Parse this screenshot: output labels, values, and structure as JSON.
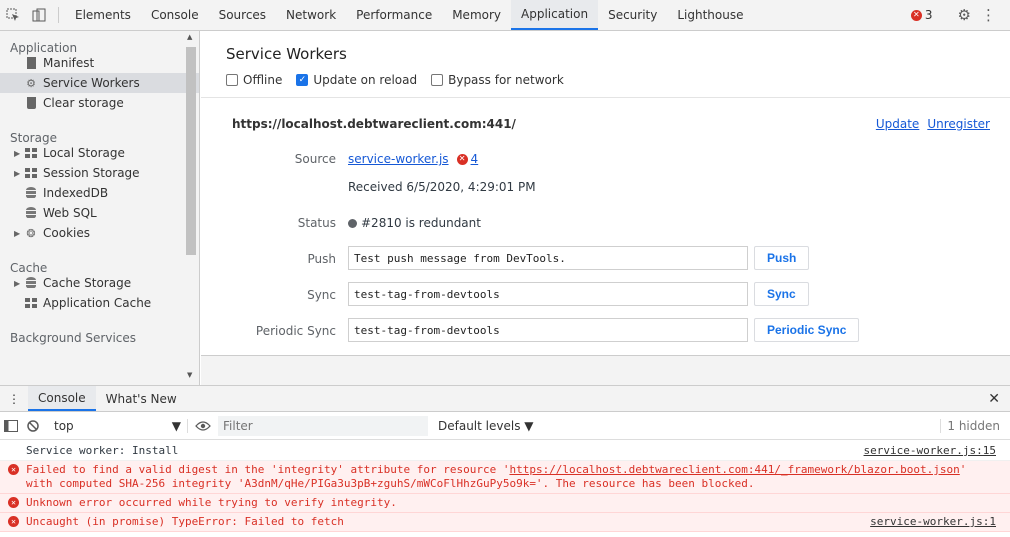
{
  "toolbar": {
    "tabs": [
      "Elements",
      "Console",
      "Sources",
      "Network",
      "Performance",
      "Memory",
      "Application",
      "Security",
      "Lighthouse"
    ],
    "active_tab": "Application",
    "error_count": "3"
  },
  "sidebar": {
    "application": {
      "title": "Application",
      "items": [
        "Manifest",
        "Service Workers",
        "Clear storage"
      ]
    },
    "storage": {
      "title": "Storage",
      "items": [
        "Local Storage",
        "Session Storage",
        "IndexedDB",
        "Web SQL",
        "Cookies"
      ]
    },
    "cache": {
      "title": "Cache",
      "items": [
        "Cache Storage",
        "Application Cache"
      ]
    },
    "background": {
      "title": "Background Services"
    }
  },
  "main": {
    "title": "Service Workers",
    "options": [
      {
        "label": "Offline",
        "checked": false
      },
      {
        "label": "Update on reload",
        "checked": true
      },
      {
        "label": "Bypass for network",
        "checked": false
      }
    ],
    "origin": "https://localhost.debtwareclient.com:441/",
    "update_label": "Update",
    "unregister_label": "Unregister",
    "source_label": "Source",
    "source_file": "service-worker.js",
    "source_errors": "4",
    "received": "Received 6/5/2020, 4:29:01 PM",
    "status_label": "Status",
    "status_value": "#2810 is redundant",
    "push_label": "Push",
    "push_value": "Test push message from DevTools.",
    "push_button": "Push",
    "sync_label": "Sync",
    "sync_value": "test-tag-from-devtools",
    "sync_button": "Sync",
    "periodic_label": "Periodic Sync",
    "periodic_value": "test-tag-from-devtools",
    "periodic_button": "Periodic Sync"
  },
  "drawer": {
    "tabs": [
      "Console",
      "What's New"
    ],
    "context": "top",
    "filter_placeholder": "Filter",
    "levels": "Default levels",
    "hidden": "1 hidden"
  },
  "console": {
    "m1_text": "Service worker: Install",
    "m1_loc": "service-worker.js:15",
    "m2_pre": "Failed to find a valid digest in the 'integrity' attribute for resource '",
    "m2_url": "https://localhost.debtwareclient.com:441/_framework/blazor.boot.json",
    "m2_post": "' with computed SHA-256 integrity 'A3dnM/qHe/PIGa3u3pB+zguhS/mWCoFlHhzGuPy5o9k='. The resource has been blocked.",
    "m3_text": "Unknown error occurred while trying to verify integrity.",
    "m4_text": "Uncaught (in promise) TypeError: Failed to fetch",
    "m4_loc": "service-worker.js:1"
  }
}
